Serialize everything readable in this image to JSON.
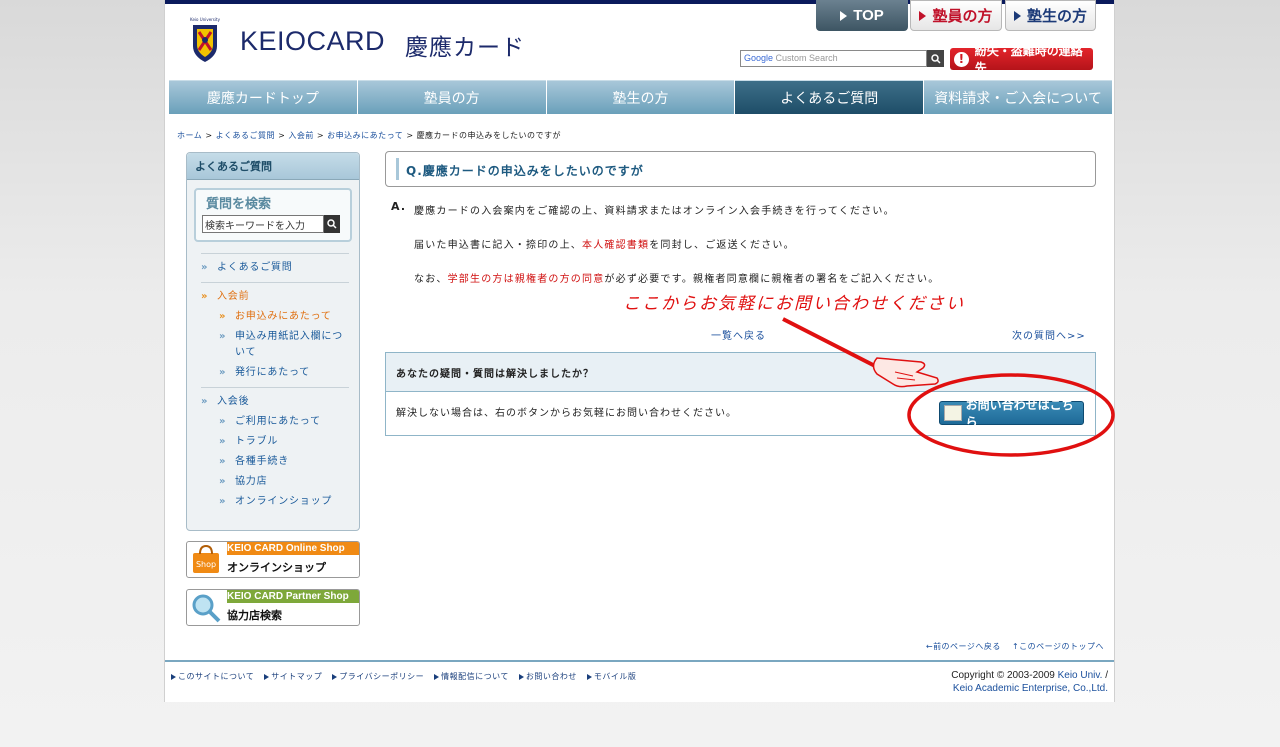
{
  "header": {
    "brand": "KEIOCARD",
    "brand_jp": "慶應カード",
    "logo_text": "Keio University",
    "top_nav": {
      "top": "TOP",
      "member": "塾員の方",
      "student": "塾生の方"
    },
    "search_placeholder": "Custom Search",
    "search_brand": "Google",
    "lost_button": "紛失・盗難時の連絡先"
  },
  "main_nav": [
    {
      "label": "慶應カードトップ"
    },
    {
      "label": "塾員の方"
    },
    {
      "label": "塾生の方"
    },
    {
      "label": "よくあるご質問"
    },
    {
      "label": "資料請求・ご入会について"
    }
  ],
  "breadcrumb": {
    "home": "ホーム",
    "faq": "よくあるご質問",
    "before": "入会前",
    "apply": "お申込みにあたって",
    "current": "慶應カードの申込みをしたいのですが",
    "sep": ">"
  },
  "sidebar": {
    "title": "よくあるご質問",
    "search_title": "質問を検索",
    "search_value": "検索キーワードを入力",
    "faq_link": "よくあるご質問",
    "before_join": "入会前",
    "before_items": [
      "お申込みにあたって",
      "申込み用紙記入欄について",
      "発行にあたって"
    ],
    "after_join": "入会後",
    "after_items": [
      "ご利用にあたって",
      "トラブル",
      "各種手続き",
      "協力店",
      "オンラインショップ"
    ]
  },
  "banners": {
    "shop_top": "KEIO CARD Online Shop",
    "shop_label": "オンラインショップ",
    "shop_icon": "Shop",
    "partner_top": "KEIO CARD Partner Shop",
    "partner_label": "協力店検索"
  },
  "question": {
    "title": "Q.慶應カードの申込みをしたいのですが",
    "a_label": "A.",
    "answer_1": "慶應カードの入会案内をご確認の上、資料請求またはオンライン入会手続きを行ってください。",
    "answer_2_pre": "届いた申込書に記入・捺印の上、",
    "answer_2_red": "本人確認書類",
    "answer_2_post": "を同封し、ご返送ください。",
    "answer_3_pre": "なお、",
    "answer_3_red": "学部生の方は親権者の方の同意",
    "answer_3_post": "が必ず必要です。親権者同意欄に親権者の署名をご記入ください。",
    "handwritten_note": "ここからお気軽にお問い合わせください",
    "list_back": "一覧へ戻る",
    "next": "次の質問へ>>"
  },
  "solve": {
    "heading": "あなたの疑問・質問は解決しましたか？",
    "body": "解決しない場合は、右のボタンからお気軽にお問い合わせください。",
    "contact_button": "お問い合わせはこちら"
  },
  "page_links": {
    "back": "←前のページへ戻る",
    "top": "↑このページのトップへ"
  },
  "footer": {
    "links": [
      "このサイトについて",
      "サイトマップ",
      "プライバシーポリシー",
      "情報配信について",
      "お問い合わせ",
      "モバイル版"
    ],
    "copyright_prefix": "Copyright © 2003-2009",
    "keio_univ": "Keio Univ.",
    "slash": "/",
    "enterprise": "Keio Academic Enterprise, Co.,Ltd."
  },
  "colors": {
    "brand_navy": "#1c2a6b",
    "nav_blue": "#6aa0ba",
    "nav_active": "#1e4d68",
    "alert_red": "#d01010",
    "link_blue": "#1a4f9c"
  }
}
